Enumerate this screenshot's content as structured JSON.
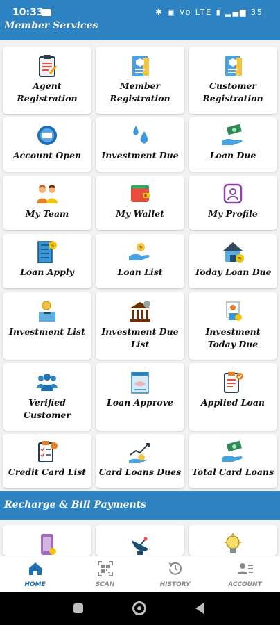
{
  "status_bar": {
    "time": "10:33",
    "right_indicators": "✱ ▣ Vo LTE ▮ ▂▄▆ 35"
  },
  "sections": {
    "member_services": "Member Services",
    "recharge": "Recharge & Bill Payments"
  },
  "grid": [
    {
      "label": "Agent Registration",
      "icon": "clipboard-icon"
    },
    {
      "label": "Member Registration",
      "icon": "id-card-icon"
    },
    {
      "label": "Customer Registration",
      "icon": "id-card-icon"
    },
    {
      "label": "Account Open",
      "icon": "passbook-icon"
    },
    {
      "label": "Investment Due",
      "icon": "water-drops-icon"
    },
    {
      "label": "Loan Due",
      "icon": "money-hand-icon"
    },
    {
      "label": "My Team",
      "icon": "team-icon"
    },
    {
      "label": "My Wallet",
      "icon": "wallet-icon"
    },
    {
      "label": "My Profile",
      "icon": "profile-icon"
    },
    {
      "label": "Loan Apply",
      "icon": "building-dollar-icon"
    },
    {
      "label": "Loan List",
      "icon": "coin-hand-icon"
    },
    {
      "label": "Today Loan Due",
      "icon": "house-dollar-icon"
    },
    {
      "label": "Investment List",
      "icon": "coin-box-icon"
    },
    {
      "label": "Investment Due List",
      "icon": "bank-icon"
    },
    {
      "label": "Investment Today Due",
      "icon": "doc-coin-icon"
    },
    {
      "label": "Verified Customer",
      "icon": "users-icon"
    },
    {
      "label": "Loan Approve",
      "icon": "handshake-doc-icon"
    },
    {
      "label": "Applied Loan",
      "icon": "clipboard-check-icon"
    },
    {
      "label": "Credit Card List",
      "icon": "checklist-icon"
    },
    {
      "label": "Card Loans Dues",
      "icon": "growth-coins-icon"
    },
    {
      "label": "Total Card Loans",
      "icon": "money-hand-icon"
    }
  ],
  "recharge_items": [
    {
      "icon": "phone-recharge-icon"
    },
    {
      "icon": "satellite-dish-icon"
    },
    {
      "icon": "bulb-icon"
    }
  ],
  "bottom_nav": [
    {
      "label": "HOME",
      "icon": "home-icon",
      "active": true
    },
    {
      "label": "SCAN",
      "icon": "qr-scan-icon",
      "active": false
    },
    {
      "label": "HISTORY",
      "icon": "history-icon",
      "active": false
    },
    {
      "label": "ACCOUNT",
      "icon": "account-icon",
      "active": false
    }
  ],
  "colors": {
    "primary": "#2d82c1",
    "active": "#1f6fb2"
  }
}
